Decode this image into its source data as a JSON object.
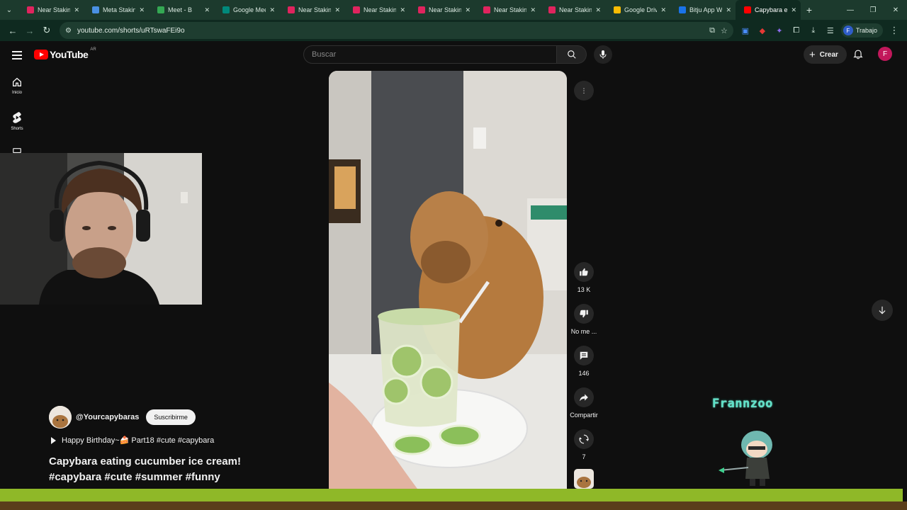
{
  "browser": {
    "tabs": [
      {
        "title": "Near Staking",
        "color": "#e0245e"
      },
      {
        "title": "Meta Staking",
        "color": "#4a90e2"
      },
      {
        "title": "Meet - B",
        "color": "#34a853"
      },
      {
        "title": "Google Meet",
        "color": "#00897b"
      },
      {
        "title": "Near Staking",
        "color": "#e0245e"
      },
      {
        "title": "Near Staking",
        "color": "#e0245e"
      },
      {
        "title": "Near Staking",
        "color": "#e0245e"
      },
      {
        "title": "Near Staking",
        "color": "#e0245e"
      },
      {
        "title": "Near Staking",
        "color": "#e0245e"
      },
      {
        "title": "Google Drive",
        "color": "#fbbc04"
      },
      {
        "title": "Bitju App W",
        "color": "#1a73e8"
      },
      {
        "title": "Capybara ea",
        "color": "#ff0000",
        "active": true
      }
    ],
    "url": "youtube.com/shorts/uRTswaFEi9o",
    "profile_initial": "F",
    "profile_label": "Trabajo"
  },
  "youtube": {
    "logo_text": "YouTube",
    "country_code": "AR",
    "search_placeholder": "Buscar",
    "create_label": "Crear",
    "avatar_initial": "F",
    "guide": [
      {
        "label": "Inicio",
        "icon": "home-icon"
      },
      {
        "label": "Shorts",
        "icon": "shorts-icon"
      }
    ]
  },
  "short": {
    "channel": "@Yourcapybaras",
    "subscribe_label": "Suscribirme",
    "related_label": "Happy Birthday~🍰 Part18 #cute #capybara",
    "title": "Capybara eating cucumber ice cream! #capybara #cute #summer #funny",
    "actions": {
      "likes": "13 K",
      "dislike_label": "No me ...",
      "comments": "146",
      "share_label": "Compartir",
      "remix_count": "7"
    }
  },
  "overlay": {
    "watermark": "Frannzoo"
  }
}
